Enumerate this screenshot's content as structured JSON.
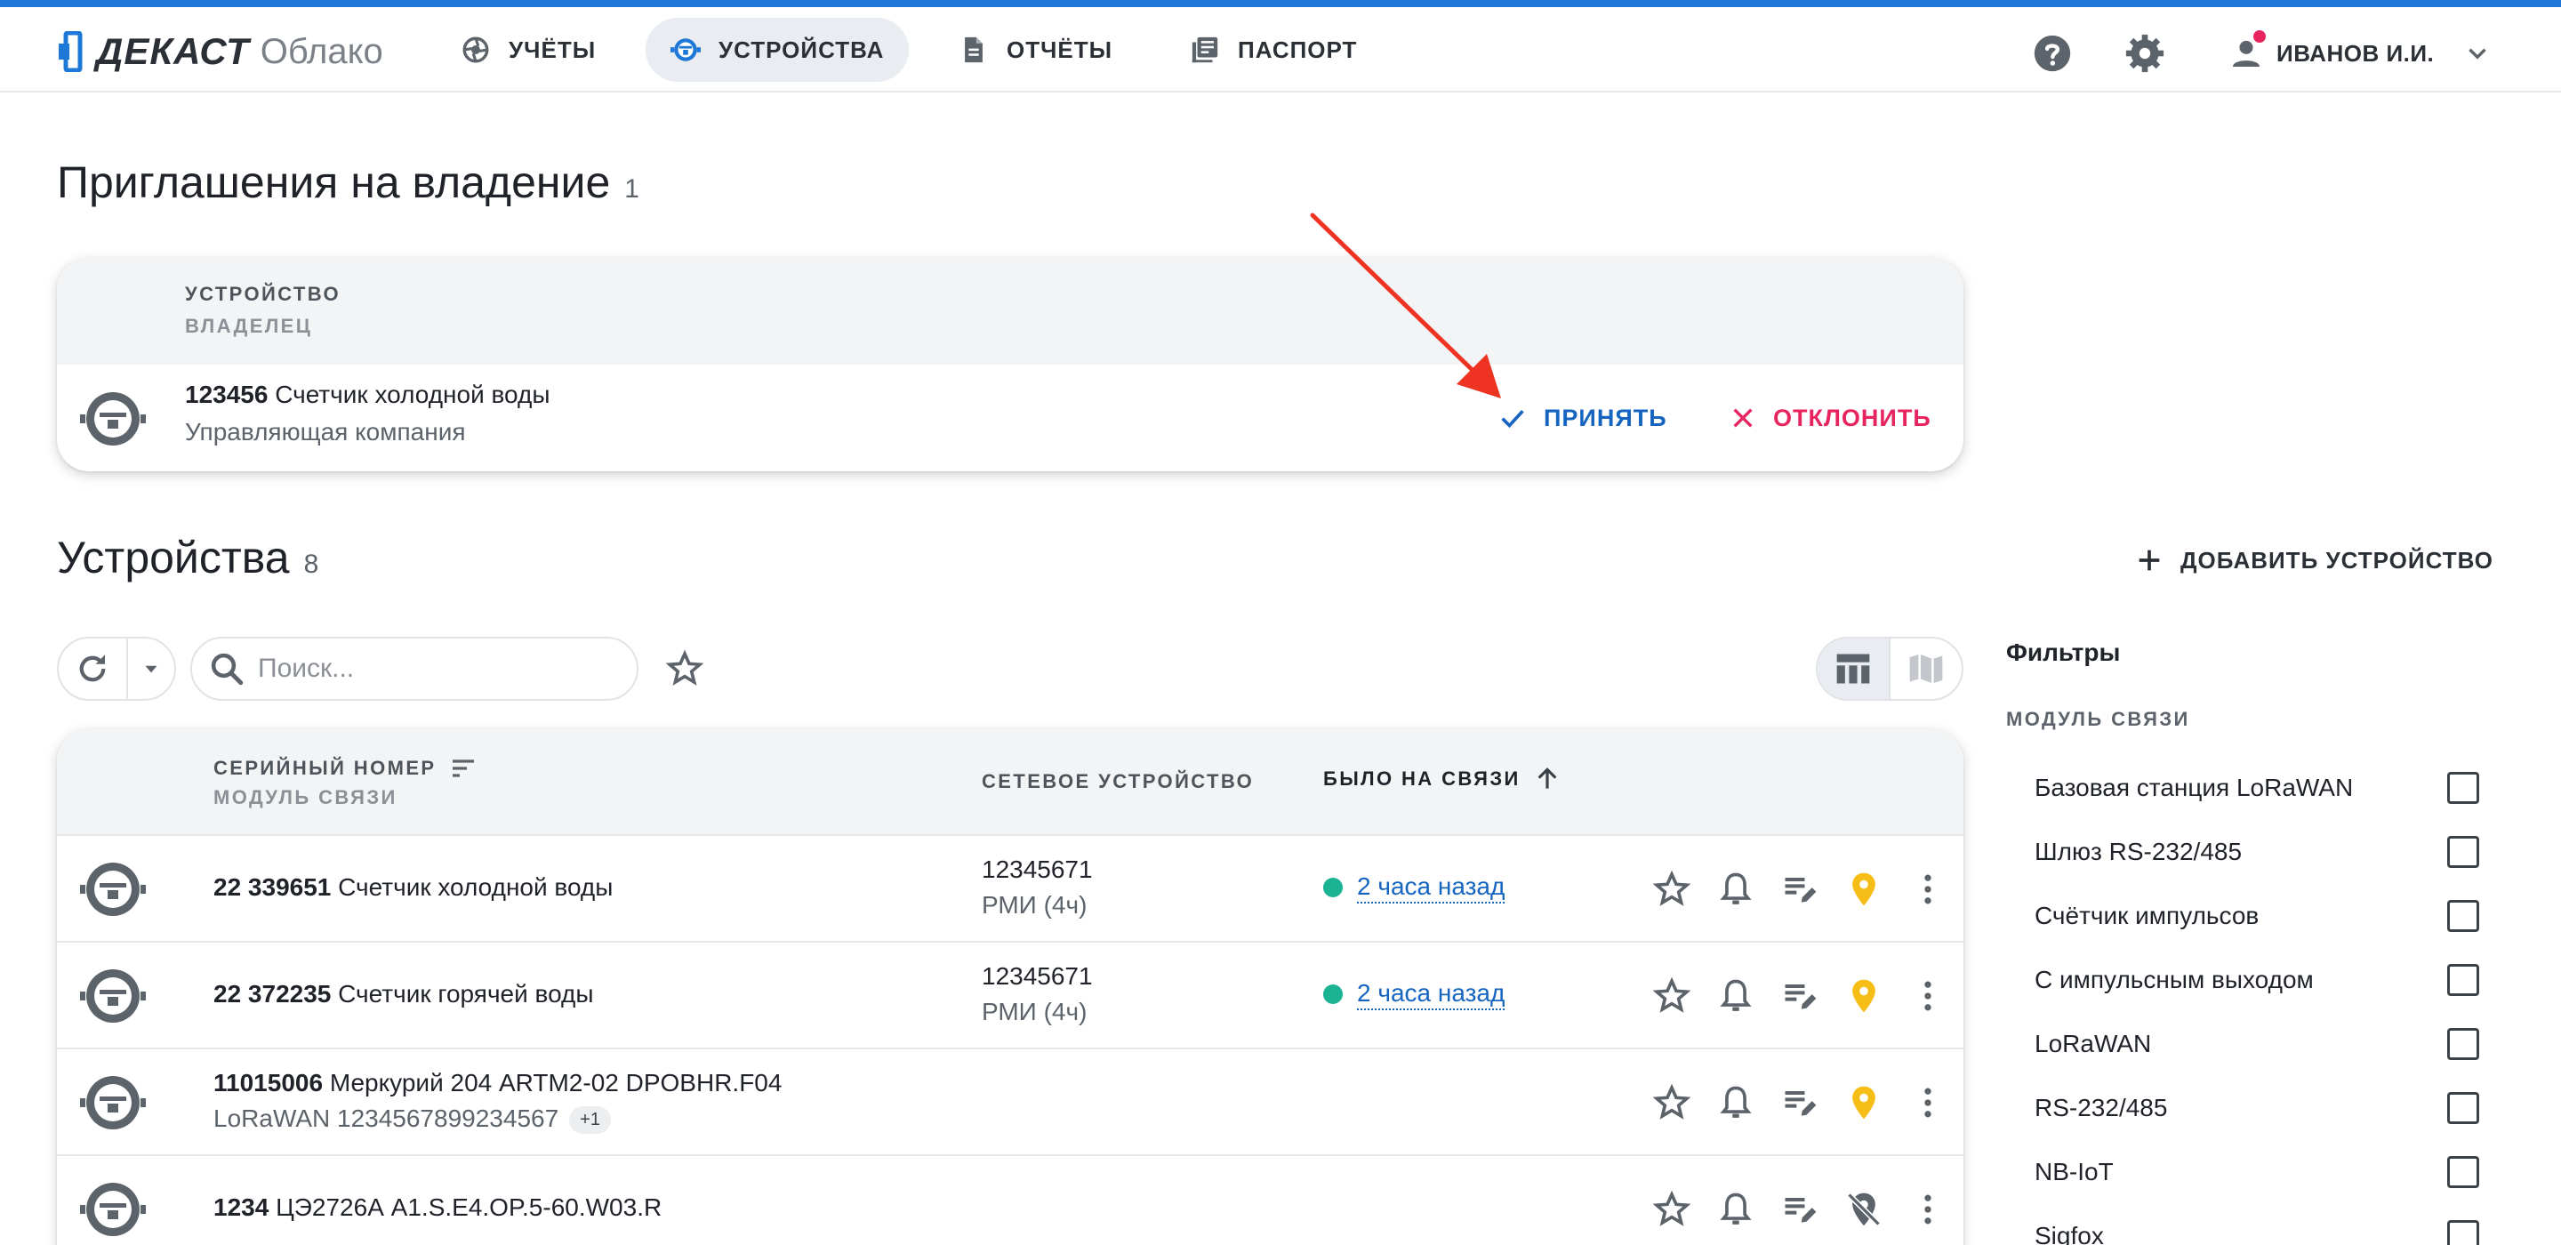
{
  "brand": {
    "name": "ДЕКАСТ",
    "product": "Облако"
  },
  "nav": [
    {
      "label": "УЧЁТЫ",
      "icon": "aperture-icon",
      "active": false
    },
    {
      "label": "УСТРОЙСТВА",
      "icon": "meter-icon",
      "active": true
    },
    {
      "label": "ОТЧЁТЫ",
      "icon": "document-icon",
      "active": false
    },
    {
      "label": "ПАСПОРТ",
      "icon": "library-icon",
      "active": false
    }
  ],
  "user": {
    "name": "ИВАНОВ И.И."
  },
  "invitations": {
    "title": "Приглашения на владение",
    "count": "1",
    "col_device": "УСТРОЙСТВО",
    "col_owner": "ВЛАДЕЛЕЦ",
    "rows": [
      {
        "serial": "123456",
        "name": "Счетчик холодной воды",
        "owner": "Управляющая компания"
      }
    ],
    "accept_label": "ПРИНЯТЬ",
    "decline_label": "ОТКЛОНИТЬ"
  },
  "devices": {
    "title": "Устройства",
    "count": "8",
    "add_label": "ДОБАВИТЬ УСТРОЙСТВО",
    "search_placeholder": "Поиск...",
    "col_serial": "СЕРИЙНЫЙ НОМЕР",
    "col_module": "МОДУЛЬ СВЯЗИ",
    "col_network": "СЕТЕВОЕ УСТРОЙСТВО",
    "col_last_seen": "БЫЛО НА СВЯЗИ",
    "rows": [
      {
        "serial": "22 339651",
        "name": "Счетчик холодной воды",
        "module": "",
        "extra": "",
        "network": "12345671",
        "network_sub": "РМИ (4ч)",
        "last_seen": "2 часа назад",
        "location": "pin"
      },
      {
        "serial": "22 372235",
        "name": "Счетчик горячей воды",
        "module": "",
        "extra": "",
        "network": "12345671",
        "network_sub": "РМИ (4ч)",
        "last_seen": "2 часа назад",
        "location": "pin"
      },
      {
        "serial": "11015006",
        "name": "Меркурий 204 ARTM2-02 DPOBHR.F04",
        "module": "LoRaWAN 1234567899234567",
        "extra": "+1",
        "network": "",
        "network_sub": "",
        "last_seen": "",
        "location": "pin"
      },
      {
        "serial": "1234",
        "name": "ЦЭ2726А А1.S.E4.OP.5-60.W03.R",
        "module": "",
        "extra": "",
        "network": "",
        "network_sub": "",
        "last_seen": "",
        "location": "pin-off"
      }
    ]
  },
  "filters": {
    "title": "Фильтры",
    "group": "МОДУЛЬ СВЯЗИ",
    "items": [
      "Базовая станция LoRaWAN",
      "Шлюз RS-232/485",
      "Счётчик импульсов",
      "С импульсным выходом",
      "LoRaWAN",
      "RS-232/485",
      "NB-IoT",
      "Sigfox"
    ]
  },
  "colors": {
    "accent": "#1e78d7",
    "link": "#1565c0",
    "danger": "#e8245f",
    "online": "#1bb394",
    "pin": "#f6bd16",
    "annotation": "#ee3322"
  }
}
